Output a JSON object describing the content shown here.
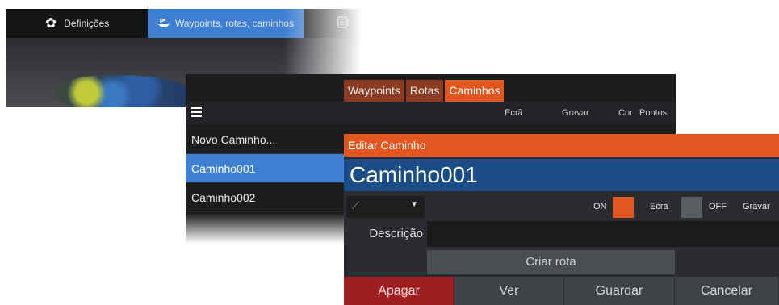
{
  "colors": {
    "accent_orange": "#e2561f",
    "tab_inactive": "#8b3b21",
    "selection_blue": "#3d7fd1",
    "name_bar_blue": "#1b4d86",
    "danger_red": "#9e1e22"
  },
  "menubar": {
    "items": [
      {
        "label": "Definições",
        "icon": "gear-icon"
      },
      {
        "label": "Waypoints, rotas, caminhos",
        "icon": "boat-icon",
        "selected": true
      },
      {
        "label": "",
        "icon": "tides-icon"
      }
    ]
  },
  "list_panel": {
    "tabs": [
      {
        "label": "Waypoints"
      },
      {
        "label": "Rotas"
      },
      {
        "label": "Caminhos",
        "active": true
      }
    ],
    "columns": [
      "Ecrã",
      "Gravar",
      "Cor",
      "Pontos"
    ],
    "rows": [
      {
        "label": "Novo Caminho..."
      },
      {
        "label": "Caminho001",
        "selected": true
      },
      {
        "label": "Caminho002"
      }
    ]
  },
  "dialog": {
    "title": "Editar Caminho",
    "name": "Caminho001",
    "line_style_icon": "line-style-icon",
    "display_toggle": {
      "state_label": "ON",
      "label": "Ecrã",
      "on": true
    },
    "record_toggle": {
      "state_label": "OFF",
      "label": "Gravar",
      "on": false
    },
    "description": {
      "label": "Descrição",
      "value": ""
    },
    "create_route_label": "Criar rota",
    "footer": {
      "delete": "Apagar",
      "view": "Ver",
      "save": "Guardar",
      "cancel": "Cancelar"
    }
  }
}
